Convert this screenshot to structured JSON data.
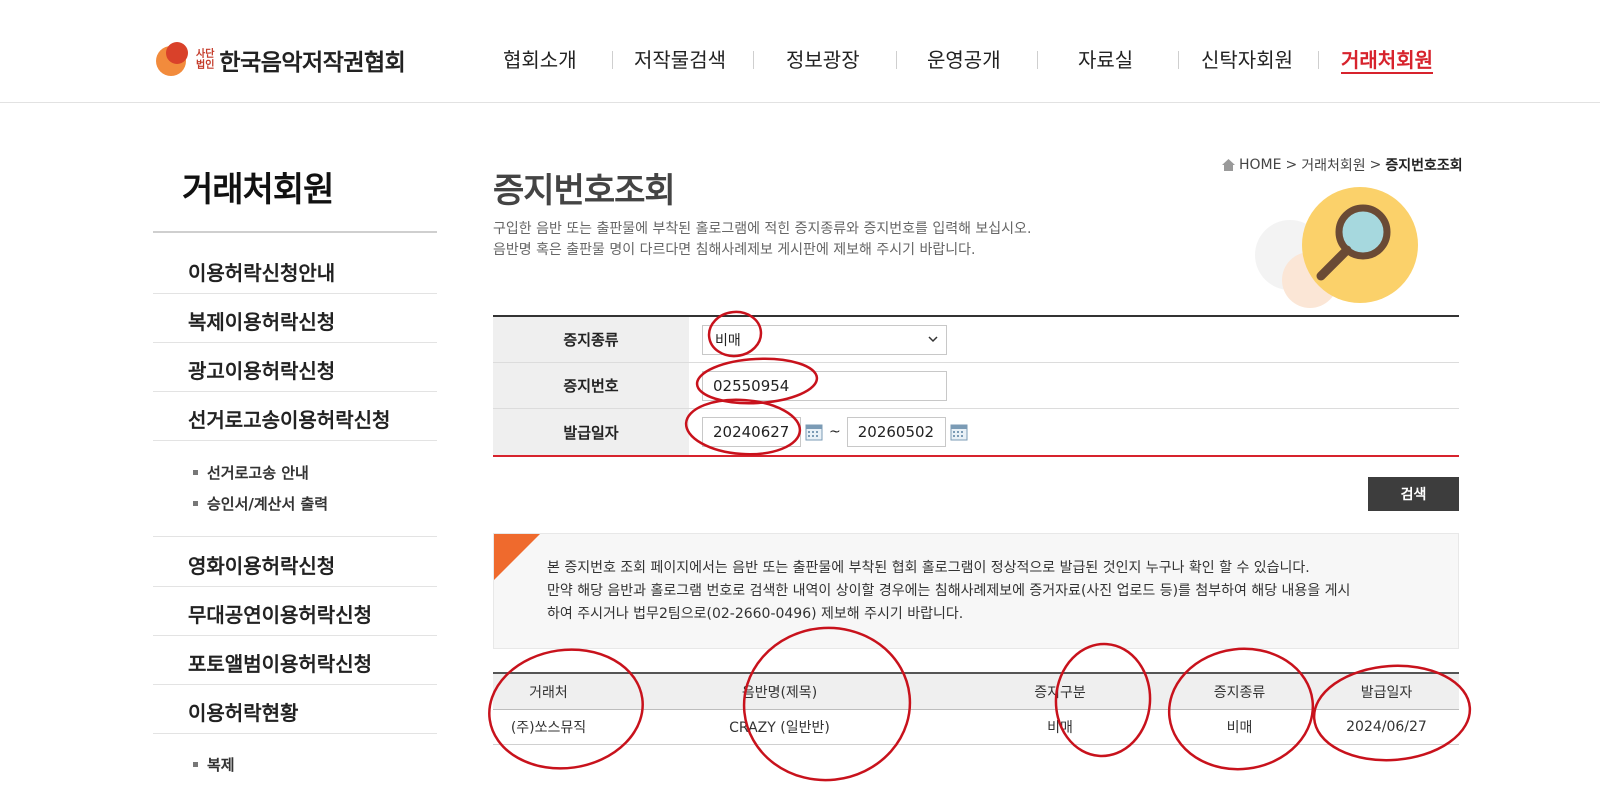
{
  "header": {
    "logo": {
      "small_top": "사단",
      "small_bottom": "법인",
      "name": "한국음악저작권협회"
    },
    "nav": [
      {
        "label": "협회소개",
        "active": false
      },
      {
        "label": "저작물검색",
        "active": false
      },
      {
        "label": "정보광장",
        "active": false
      },
      {
        "label": "운영공개",
        "active": false
      },
      {
        "label": "자료실",
        "active": false
      },
      {
        "label": "신탁자회원",
        "active": false
      },
      {
        "label": "거래처회원",
        "active": true
      }
    ]
  },
  "sidebar": {
    "title": "거래처회원",
    "items": [
      {
        "label": "이용허락신청안내"
      },
      {
        "label": "복제이용허락신청"
      },
      {
        "label": "광고이용허락신청"
      },
      {
        "label": "선거로고송이용허락신청"
      }
    ],
    "subitems": [
      {
        "label": "선거로고송 안내"
      },
      {
        "label": "승인서/계산서 출력"
      }
    ],
    "items2": [
      {
        "label": "영화이용허락신청"
      },
      {
        "label": "무대공연이용허락신청"
      },
      {
        "label": "포토앨범이용허락신청"
      },
      {
        "label": "이용허락현황"
      }
    ],
    "subitems2": [
      {
        "label": "복제"
      }
    ]
  },
  "breadcrumb": {
    "home": "HOME",
    "sep": ">",
    "parent": "거래처회원",
    "current": "증지번호조회"
  },
  "page": {
    "title": "증지번호조회",
    "desc1": "구입한 음반 또는 출판물에 부착된 홀로그램에 적힌 증지종류와 증지번호를 입력해 보십시오.",
    "desc2": "음반명 혹은 출판물 명이 다르다면 침해사례제보 게시판에 제보해 주시기 바랍니다."
  },
  "form": {
    "type_label": "증지종류",
    "type_value": "비매",
    "number_label": "증지번호",
    "number_value": "02550954",
    "date_label": "발급일자",
    "date_from": "20240627",
    "date_to": "20260502",
    "tilde": "~",
    "search_button": "검색"
  },
  "notice": {
    "line1": "본 증지번호 조회 페이지에서는 음반 또는 출판물에 부착된 협회 홀로그램이 정상적으로 발급된 것인지 누구나 확인 할 수 있습니다.",
    "line2": "만약 해당 음반과 홀로그램 번호로 검색한 내역이 상이할 경우에는 침해사례제보에 증거자료(사진 업로드 등)를 첨부하여 해당 내용을 게시",
    "line3": "하여 주시거나 법무2팀으로(02-2660-0496) 제보해 주시기 바랍니다."
  },
  "results": {
    "columns": [
      "거래처",
      "음반명(제목)",
      "증지구분",
      "증지종류",
      "발급일자"
    ],
    "rows": [
      [
        "(주)쏘스뮤직",
        "CRAZY (일반반)",
        "비매",
        "비매",
        "2024/06/27"
      ]
    ]
  },
  "colors": {
    "accent_red": "#d7232d",
    "annotation_red": "#c8121c",
    "notice_corner": "#ef6a2d",
    "dark_button": "#3d3d3d"
  }
}
